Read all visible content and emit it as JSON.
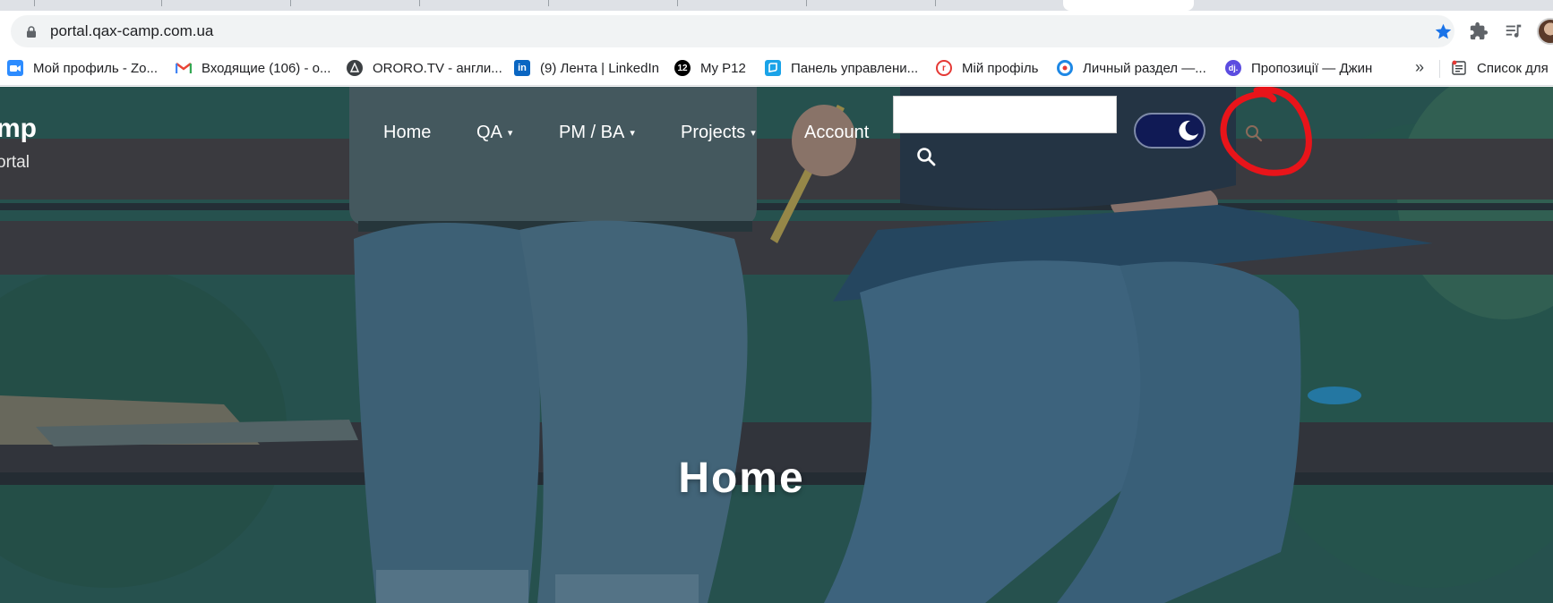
{
  "browser": {
    "url": "portal.qax-camp.com.ua",
    "bookmarks": [
      {
        "label": "Мой профиль - Zo...",
        "icon": "zoom-icon",
        "color": "#2d8cff"
      },
      {
        "label": "Входящие (106) - о...",
        "icon": "gmail-icon",
        "color": "#ea4335"
      },
      {
        "label": "ORORO.TV - англи...",
        "icon": "ororo-icon",
        "color": "#3c4043"
      },
      {
        "label": "(9) Лента | LinkedIn",
        "icon": "linkedin-icon",
        "color": "#0a66c2"
      },
      {
        "label": "My P12",
        "icon": "p12-icon",
        "badge": "12",
        "color": "#000000"
      },
      {
        "label": "Панель управлени...",
        "icon": "panel-icon",
        "color": "#1aa3e8"
      },
      {
        "label": "Мій профіль",
        "icon": "profile-r-icon",
        "color": "#e53935"
      },
      {
        "label": "Личный раздел —...",
        "icon": "target-icon",
        "color": "#1e88e5"
      },
      {
        "label": "Пропозиції — Джин",
        "icon": "djinni-icon",
        "badge": "dj.",
        "color": "#5b4ce0"
      },
      {
        "label": "Список для",
        "icon": "reading-list-icon",
        "color": "#3c4043"
      }
    ],
    "bookmarks_more": "»"
  },
  "site": {
    "title": "mp",
    "subtitle": "ortal",
    "nav": [
      {
        "label": "Home",
        "dropdown": false
      },
      {
        "label": "QA",
        "dropdown": true
      },
      {
        "label": "PM / BA",
        "dropdown": true
      },
      {
        "label": "Projects",
        "dropdown": true
      },
      {
        "label": "Account",
        "dropdown": false
      }
    ],
    "caret": "▾",
    "search": {
      "value": "",
      "placeholder": ""
    },
    "dark_mode": true,
    "annotation_color": "#e8141a"
  },
  "hero": {
    "title": "Home"
  }
}
